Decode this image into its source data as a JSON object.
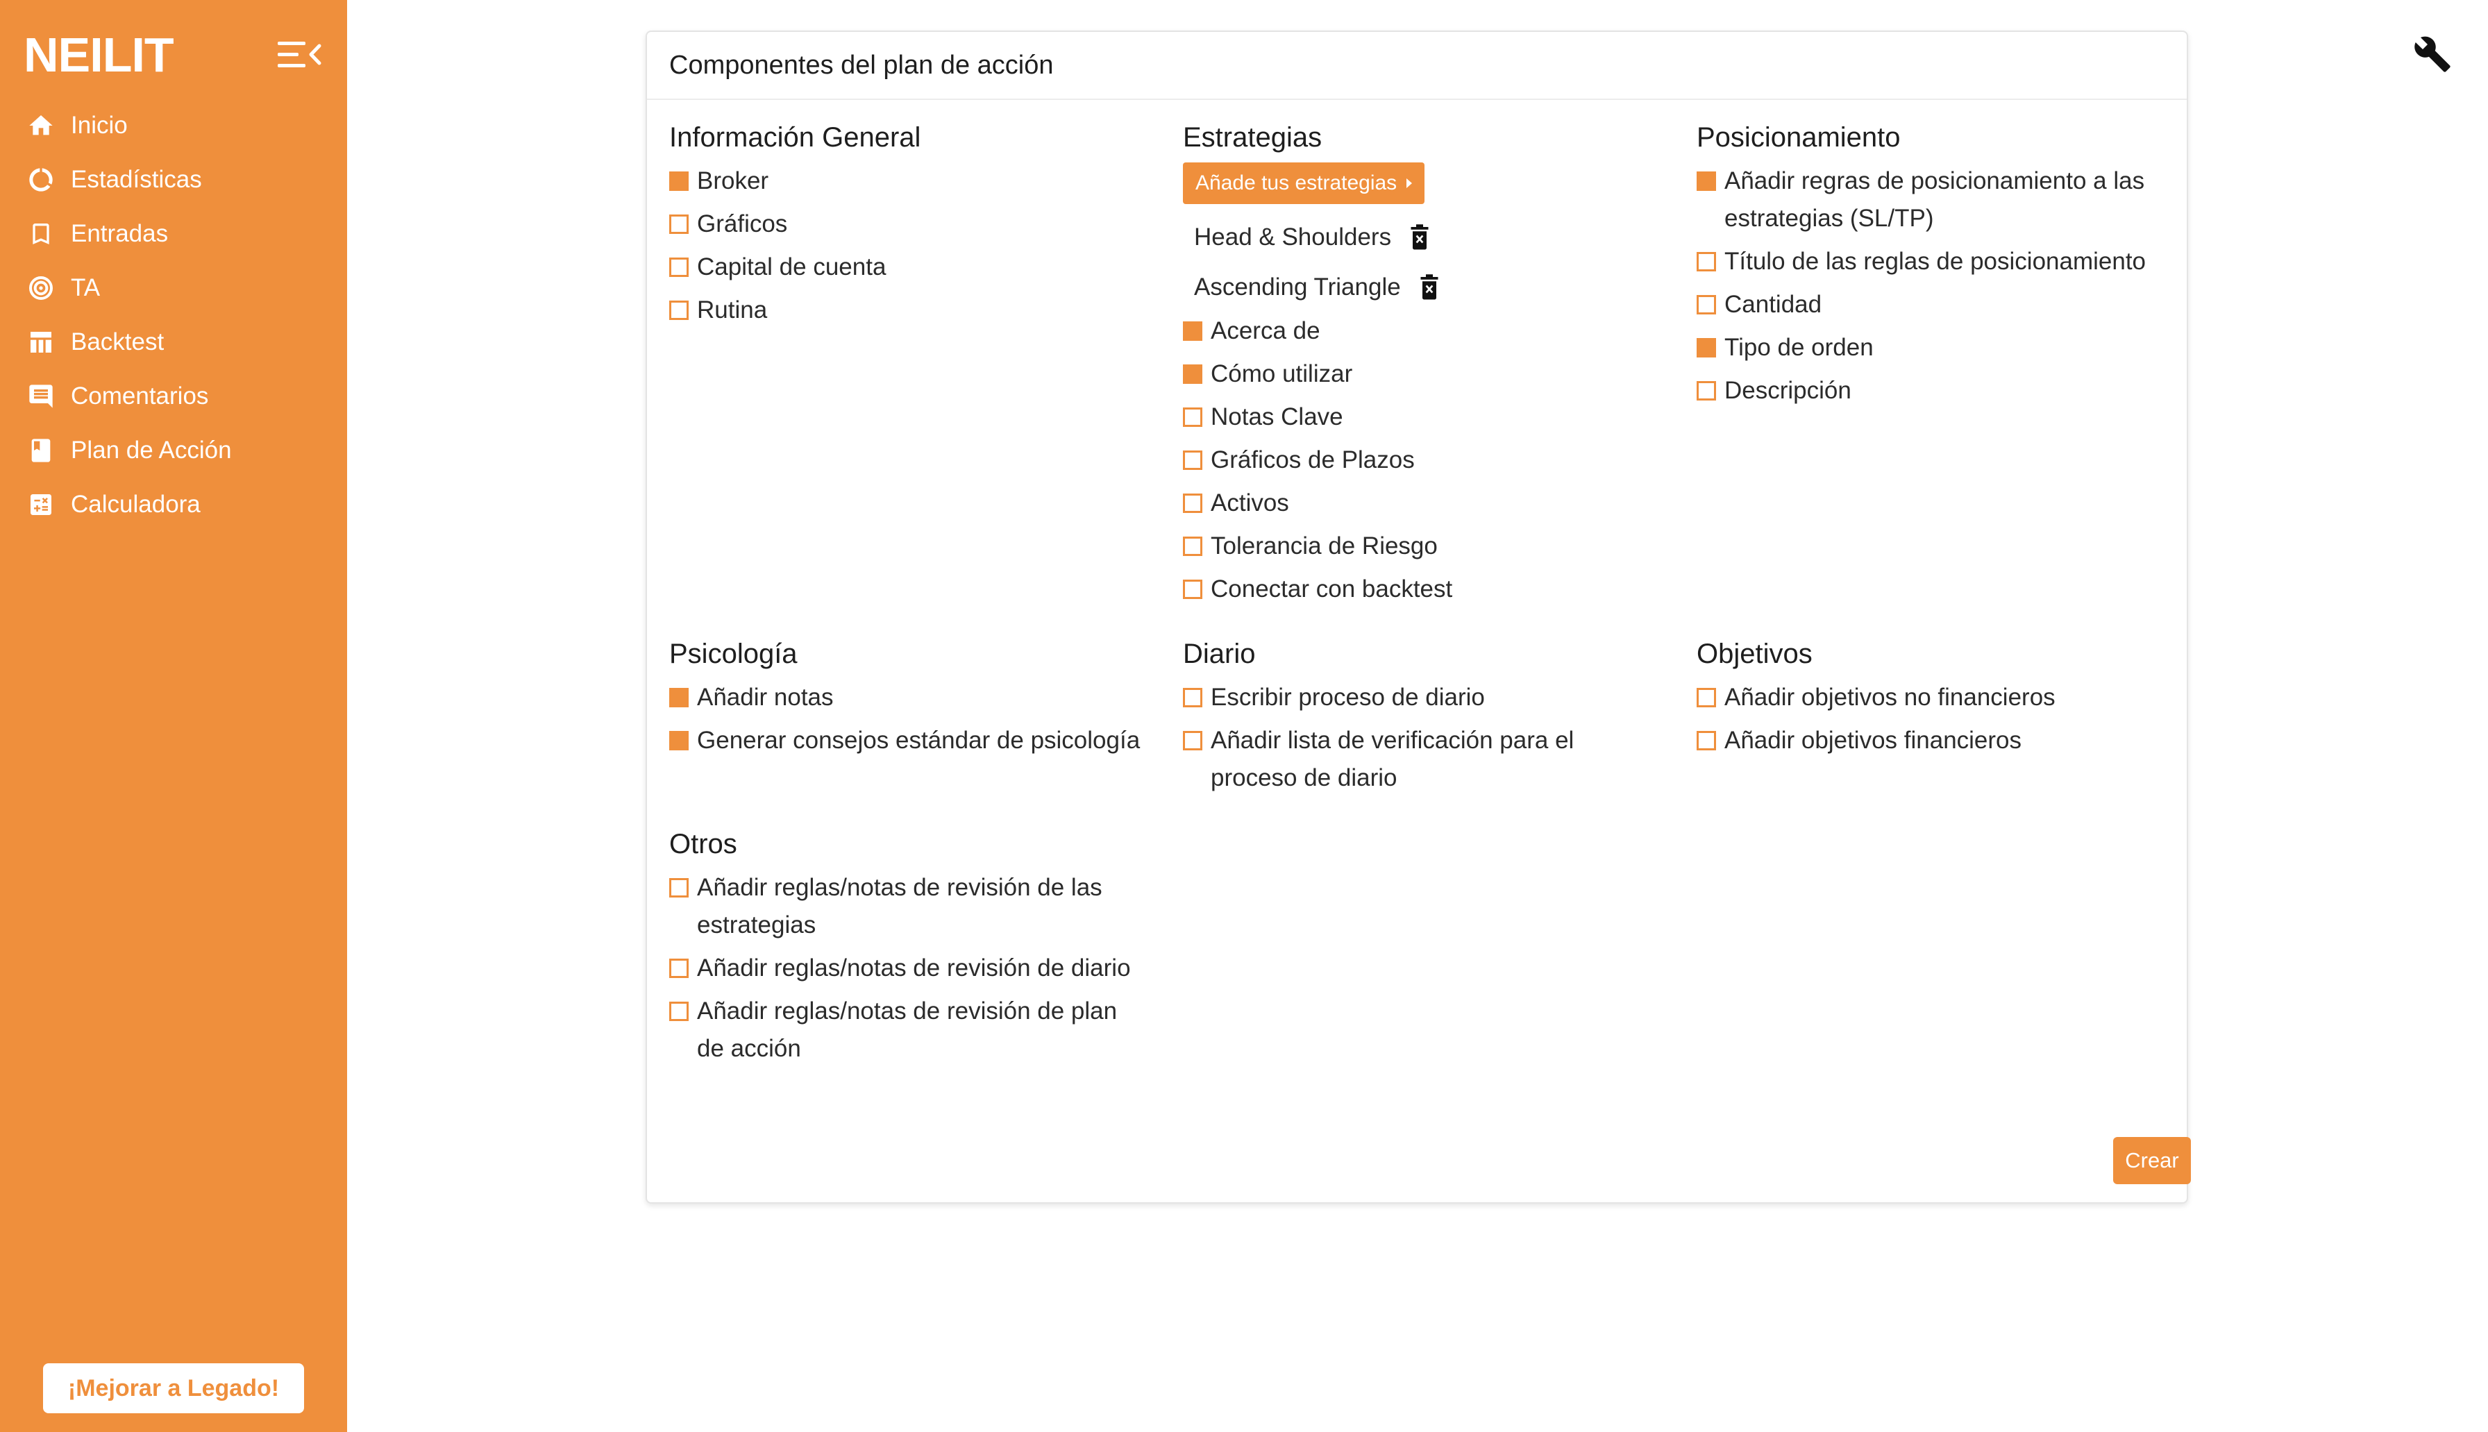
{
  "brand": "NEILIT",
  "accent_color": "#ef8f3c",
  "sidebar": {
    "collapse_icon": "menu-collapse-icon",
    "items": [
      {
        "label": "Inicio",
        "icon": "home-icon"
      },
      {
        "label": "Estadísticas",
        "icon": "donut-chart-icon"
      },
      {
        "label": "Entradas",
        "icon": "bookmark-icon"
      },
      {
        "label": "TA",
        "icon": "target-icon"
      },
      {
        "label": "Backtest",
        "icon": "table-icon"
      },
      {
        "label": "Comentarios",
        "icon": "comment-icon"
      },
      {
        "label": "Plan de Acción",
        "icon": "book-icon"
      },
      {
        "label": "Calculadora",
        "icon": "calculator-icon"
      }
    ],
    "upgrade_label": "¡Mejorar a Legado!"
  },
  "top_right_icon": "wrench-icon",
  "card": {
    "title": "Componentes del plan de acción",
    "general": {
      "title": "Información General",
      "options": [
        {
          "label": "Broker",
          "checked": true
        },
        {
          "label": "Gráficos",
          "checked": false
        },
        {
          "label": "Capital de cuenta",
          "checked": false
        },
        {
          "label": "Rutina",
          "checked": false
        }
      ]
    },
    "strategies": {
      "title": "Estrategias",
      "add_label": "Añade tus estrategias",
      "items": [
        "Head & Shoulders",
        "Ascending Triangle"
      ],
      "options": [
        {
          "label": "Acerca de",
          "checked": true
        },
        {
          "label": "Cómo utilizar",
          "checked": true
        },
        {
          "label": "Notas Clave",
          "checked": false
        },
        {
          "label": "Gráficos de Plazos",
          "checked": false
        },
        {
          "label": "Activos",
          "checked": false
        },
        {
          "label": "Tolerancia de Riesgo",
          "checked": false
        },
        {
          "label": "Conectar con backtest",
          "checked": false
        }
      ]
    },
    "positioning": {
      "title": "Posicionamiento",
      "options": [
        {
          "label": "Añadir regras de posicionamiento a las estrategias (SL/TP)",
          "checked": true
        },
        {
          "label": "Título de las reglas de posicionamiento",
          "checked": false
        },
        {
          "label": "Cantidad",
          "checked": false
        },
        {
          "label": "Tipo de orden",
          "checked": true
        },
        {
          "label": "Descripción",
          "checked": false
        }
      ]
    },
    "psychology": {
      "title": "Psicología",
      "options": [
        {
          "label": "Añadir notas",
          "checked": true
        },
        {
          "label": "Generar consejos estándar de psicología",
          "checked": true
        }
      ]
    },
    "journal": {
      "title": "Diario",
      "options": [
        {
          "label": "Escribir proceso de diario",
          "checked": false
        },
        {
          "label": "Añadir lista de verificación para el proceso de diario",
          "checked": false
        }
      ]
    },
    "objectives": {
      "title": "Objetivos",
      "options": [
        {
          "label": "Añadir objetivos no financieros",
          "checked": false
        },
        {
          "label": "Añadir objetivos financieros",
          "checked": false
        }
      ]
    },
    "others": {
      "title": "Otros",
      "options": [
        {
          "label": "Añadir reglas/notas de revisión de las estrategias",
          "checked": false
        },
        {
          "label": "Añadir reglas/notas de revisión de diario",
          "checked": false
        },
        {
          "label": "Añadir reglas/notas de revisión de plan de acción",
          "checked": false
        }
      ]
    },
    "create_label": "Crear"
  }
}
